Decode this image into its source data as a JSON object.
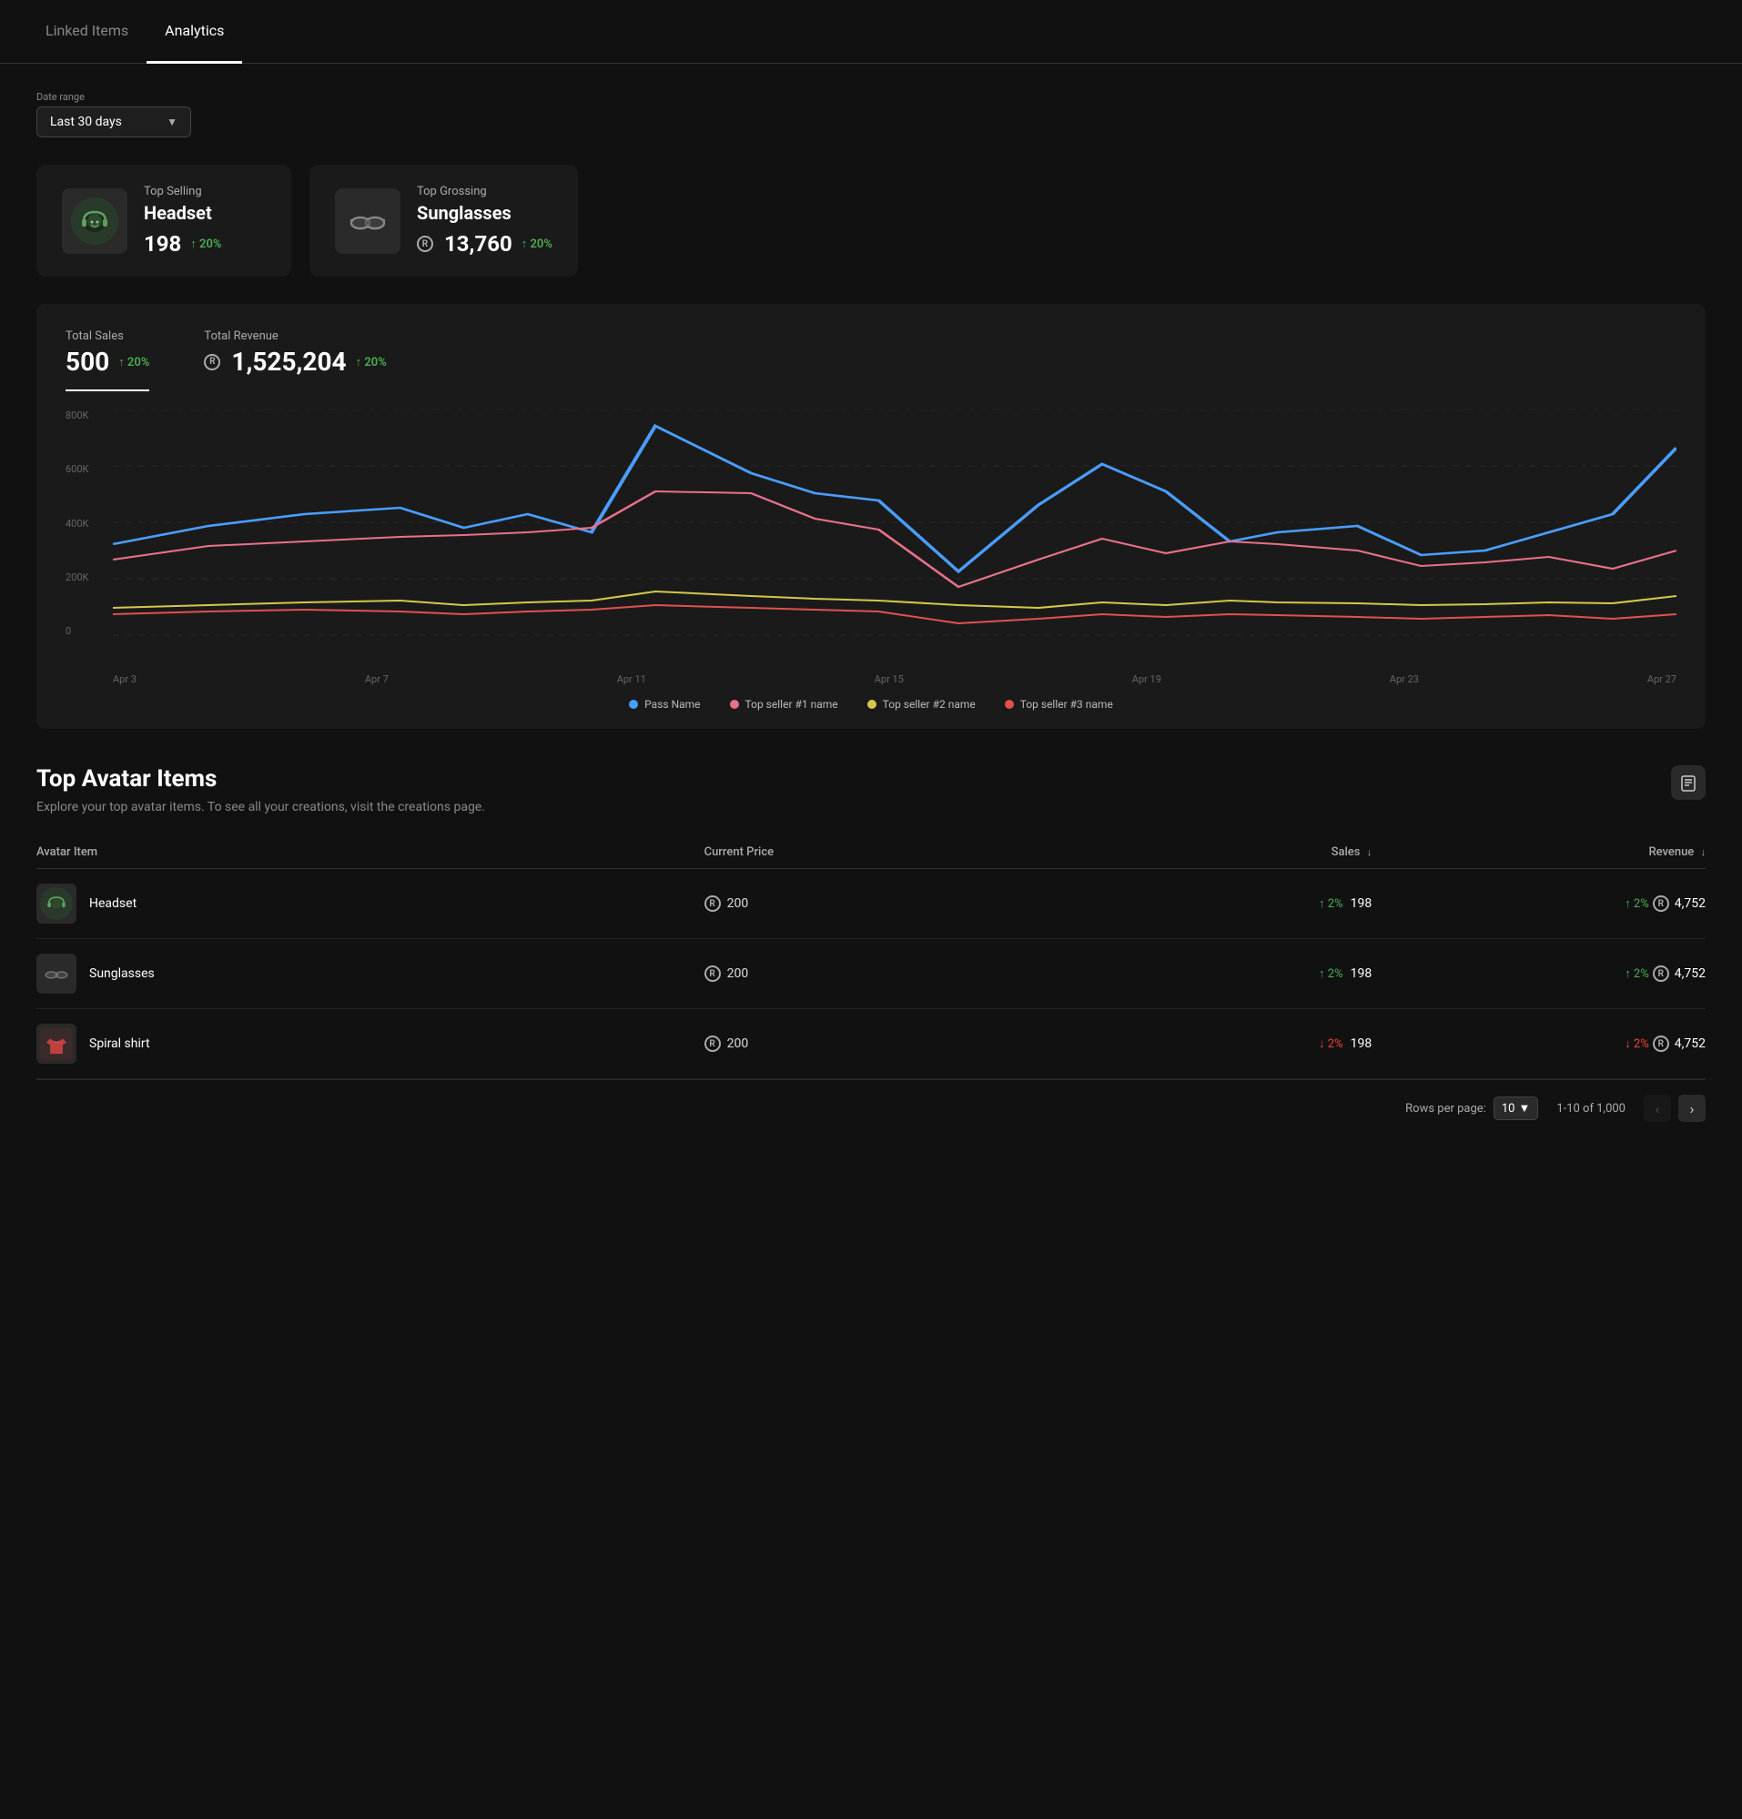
{
  "tabs": [
    {
      "label": "Linked Items",
      "active": false
    },
    {
      "label": "Analytics",
      "active": true
    }
  ],
  "dateRange": {
    "label": "Date range",
    "value": "Last 30 days"
  },
  "topCards": [
    {
      "label": "Top Selling",
      "name": "Headset",
      "value": "198",
      "change": "↑ 20%",
      "type": "count"
    },
    {
      "label": "Top Grossing",
      "name": "Sunglasses",
      "value": "13,760",
      "change": "↑ 20%",
      "type": "robux"
    }
  ],
  "chartSection": {
    "metrics": [
      {
        "label": "Total Sales",
        "value": "500",
        "change": "↑ 20%",
        "active": true
      },
      {
        "label": "Total Revenue",
        "value": "1,525,204",
        "change": "↑ 20%",
        "active": false,
        "hasRobux": true
      }
    ],
    "xLabels": [
      "Apr 3",
      "Apr 7",
      "Apr 11",
      "Apr 15",
      "Apr 19",
      "Apr 23",
      "Apr 27"
    ],
    "yLabels": [
      "800K",
      "600K",
      "400K",
      "200K",
      "0"
    ],
    "legend": [
      {
        "label": "Pass Name",
        "color": "#4a9eff"
      },
      {
        "label": "Top seller #1 name",
        "color": "#e8718a"
      },
      {
        "label": "Top seller #2 name",
        "color": "#d4c84a"
      },
      {
        "label": "Top seller #3 name",
        "color": "#e05050"
      }
    ]
  },
  "tableSection": {
    "title": "Top Avatar Items",
    "subtitle": "Explore your top avatar items. To see all your creations, visit the creations page.",
    "columns": [
      {
        "label": "Avatar Item",
        "sortable": false
      },
      {
        "label": "Current Price",
        "sortable": false
      },
      {
        "label": "Sales",
        "sortable": true
      },
      {
        "label": "Revenue",
        "sortable": true
      }
    ],
    "rows": [
      {
        "name": "Headset",
        "price": "200",
        "salesChange": "↑ 2%",
        "salesChangeDir": "up",
        "sales": "198",
        "revenueChange": "↑ 2%",
        "revenueChangeDir": "up",
        "revenue": "4,752",
        "itemType": "headset"
      },
      {
        "name": "Sunglasses",
        "price": "200",
        "salesChange": "↑ 2%",
        "salesChangeDir": "up",
        "sales": "198",
        "revenueChange": "↑ 2%",
        "revenueChangeDir": "up",
        "revenue": "4,752",
        "itemType": "sunglasses"
      },
      {
        "name": "Spiral shirt",
        "price": "200",
        "salesChange": "↓ 2%",
        "salesChangeDir": "down",
        "sales": "198",
        "revenueChange": "↓ 2%",
        "revenueChangeDir": "down",
        "revenue": "4,752",
        "itemType": "shirt"
      }
    ],
    "pagination": {
      "rowsPerPage": "10",
      "range": "1-10 of 1,000"
    }
  }
}
